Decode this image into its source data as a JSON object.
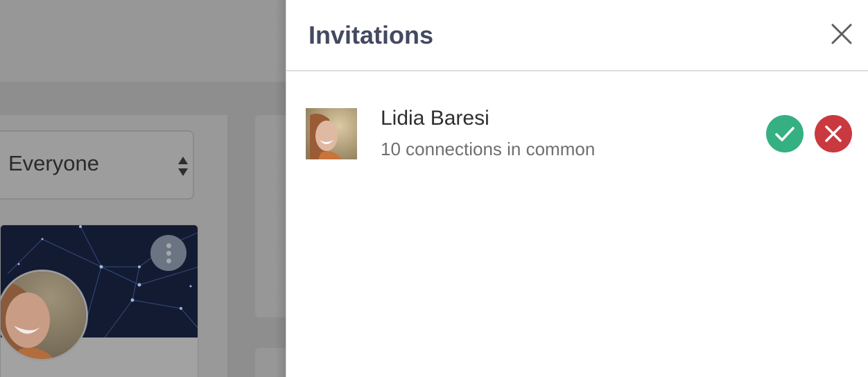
{
  "background": {
    "filter": {
      "selected_label": "Everyone"
    }
  },
  "drawer": {
    "title": "Invitations",
    "close_icon": "close-icon",
    "invitations": [
      {
        "name": "Lidia Baresi",
        "connections_text": "10 connections in common",
        "accept_icon": "check-icon",
        "decline_icon": "x-icon"
      }
    ]
  },
  "colors": {
    "title": "#434a60",
    "accept": "#35b083",
    "decline": "#c9393f",
    "overlay": "#8e8e8e"
  }
}
